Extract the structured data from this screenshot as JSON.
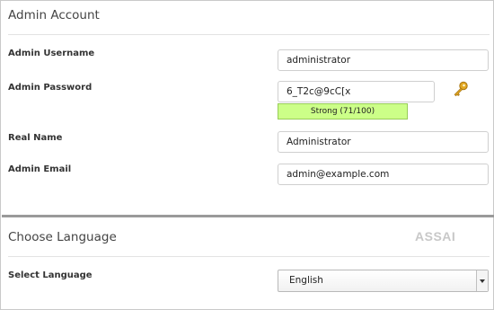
{
  "admin_account": {
    "title": "Admin Account",
    "username_label": "Admin Username",
    "username_value": "administrator",
    "password_label": "Admin Password",
    "password_value": "6_T2c@9cC[x",
    "strength_text": "Strong (71/100)",
    "strength_score": 71,
    "strength_color": "#ccff88",
    "realname_label": "Real Name",
    "realname_value": "Administrator",
    "email_label": "Admin Email",
    "email_value": "admin@example.com"
  },
  "choose_language": {
    "title": "Choose Language",
    "logo_text": "ASSAI",
    "select_label": "Select Language",
    "select_value": "English"
  }
}
